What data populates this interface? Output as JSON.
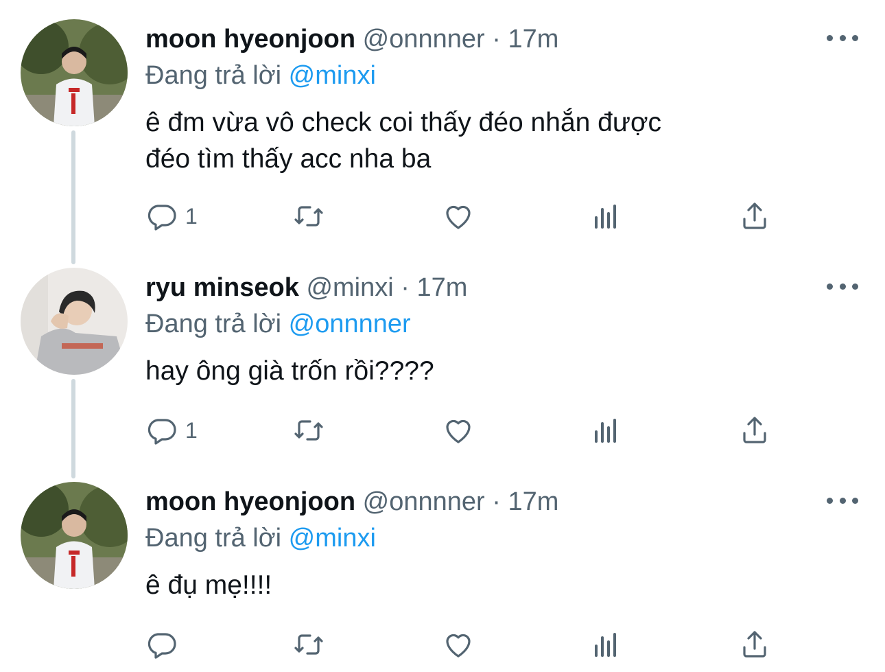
{
  "tweets": [
    {
      "display_name": "moon hyeonjoon",
      "handle": "@onnnner",
      "separator": "·",
      "time": "17m",
      "replying_prefix": "Đang trả lời",
      "replying_to": "@minxi",
      "text_lines": [
        "ê đm vừa vô check coi thấy đéo nhắn được",
        "đéo tìm thấy acc nha ba"
      ],
      "reply_count": "1",
      "retweet_count": "",
      "like_count": ""
    },
    {
      "display_name": "ryu minseok",
      "handle": "@minxi",
      "separator": "·",
      "time": "17m",
      "replying_prefix": "Đang trả lời",
      "replying_to": "@onnnner",
      "text_lines": [
        "hay ông già trốn rồi????"
      ],
      "reply_count": "1",
      "retweet_count": "",
      "like_count": ""
    },
    {
      "display_name": "moon hyeonjoon",
      "handle": "@onnnner",
      "separator": "·",
      "time": "17m",
      "replying_prefix": "Đang trả lời",
      "replying_to": "@minxi",
      "text_lines": [
        "ê đụ mẹ!!!!"
      ],
      "reply_count": "",
      "retweet_count": "",
      "like_count": ""
    }
  ],
  "icons": {
    "reply": "reply-icon",
    "retweet": "retweet-icon",
    "like": "like-icon",
    "analytics": "analytics-icon",
    "share": "share-icon",
    "more": "more-icon"
  },
  "colors": {
    "text": "#0f1419",
    "secondary": "#536471",
    "accent": "#1d9bf0",
    "thread_line": "#cfd9de"
  }
}
